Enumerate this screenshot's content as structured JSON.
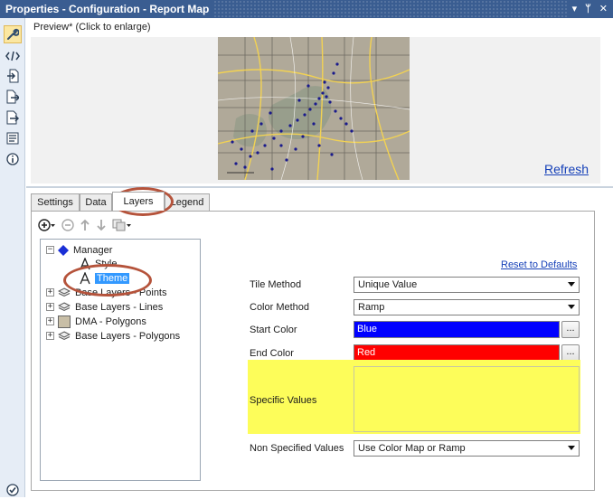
{
  "window": {
    "title": "Properties - Configuration - Report Map",
    "controls": {
      "pin": "▾",
      "autohide": "ᛘ",
      "close": "✕"
    }
  },
  "toolbar_icons": [
    "wrench-icon",
    "xml-icon",
    "input-icon",
    "output-icon",
    "export-icon",
    "annotation-icon",
    "info-icon",
    "checkmark-icon"
  ],
  "preview": {
    "label": "Preview* (Click to enlarge)",
    "refresh_label": "Refresh"
  },
  "tabs": [
    {
      "label": "Settings"
    },
    {
      "label": "Data"
    },
    {
      "label": "Layers",
      "active": true
    },
    {
      "label": "Legend"
    }
  ],
  "tree": {
    "items": [
      {
        "label": "Manager"
      },
      {
        "label": "Style"
      },
      {
        "label": "Theme",
        "selected": true
      },
      {
        "label": "Base Layers - Points"
      },
      {
        "label": "Base Layers - Lines"
      },
      {
        "label": "DMA - Polygons"
      },
      {
        "label": "Base Layers - Polygons"
      }
    ]
  },
  "form": {
    "reset_label": "Reset to Defaults",
    "tile_method": {
      "label": "Tile Method",
      "value": "Unique Value"
    },
    "color_method": {
      "label": "Color Method",
      "value": "Ramp"
    },
    "start_color": {
      "label": "Start Color",
      "value": "Blue",
      "color": "#0000ff"
    },
    "end_color": {
      "label": "End Color",
      "value": "Red",
      "color": "#ff0000"
    },
    "specific_values": {
      "label": "Specific Values",
      "value": ""
    },
    "non_specified": {
      "label": "Non Specified Values",
      "value": "Use Color Map or Ramp"
    },
    "browse_label": "..."
  },
  "colors": {
    "title_bar": "#3a5d91",
    "highlight": "#fdfd5a",
    "annotation_circle": "#b5533b",
    "selection": "#3399ff"
  }
}
